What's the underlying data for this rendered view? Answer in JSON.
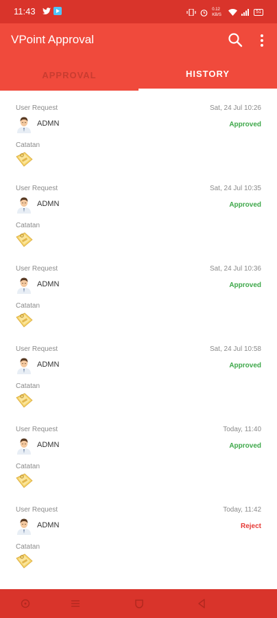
{
  "status_bar": {
    "time": "11:43",
    "battery": "51",
    "speed": "0.12 KB/S"
  },
  "app_bar": {
    "title": "VPoint Approval"
  },
  "tabs": [
    {
      "label": "APPROVAL",
      "active": false
    },
    {
      "label": "HISTORY",
      "active": true
    }
  ],
  "items": [
    {
      "request_label": "User Request",
      "date": "Sat, 24 Jul 10:26",
      "user": "ADMN",
      "status": "Approved",
      "note_label": "Catatan"
    },
    {
      "request_label": "User Request",
      "date": "Sat, 24 Jul 10:35",
      "user": "ADMN",
      "status": "Approved",
      "note_label": "Catatan"
    },
    {
      "request_label": "User Request",
      "date": "Sat, 24 Jul 10:36",
      "user": "ADMN",
      "status": "Approved",
      "note_label": "Catatan"
    },
    {
      "request_label": "User Request",
      "date": "Sat, 24 Jul 10:58",
      "user": "ADMN",
      "status": "Approved",
      "note_label": "Catatan"
    },
    {
      "request_label": "User Request",
      "date": "Today, 11:40",
      "user": "ADMN",
      "status": "Approved",
      "note_label": "Catatan"
    },
    {
      "request_label": "User Request",
      "date": "Today, 11:42",
      "user": "ADMN",
      "status": "Reject",
      "note_label": "Catatan"
    }
  ],
  "colors": {
    "primary": "#f04a3c",
    "status_bar": "#d9342b",
    "approved": "#3ea84a",
    "reject": "#e53935"
  }
}
